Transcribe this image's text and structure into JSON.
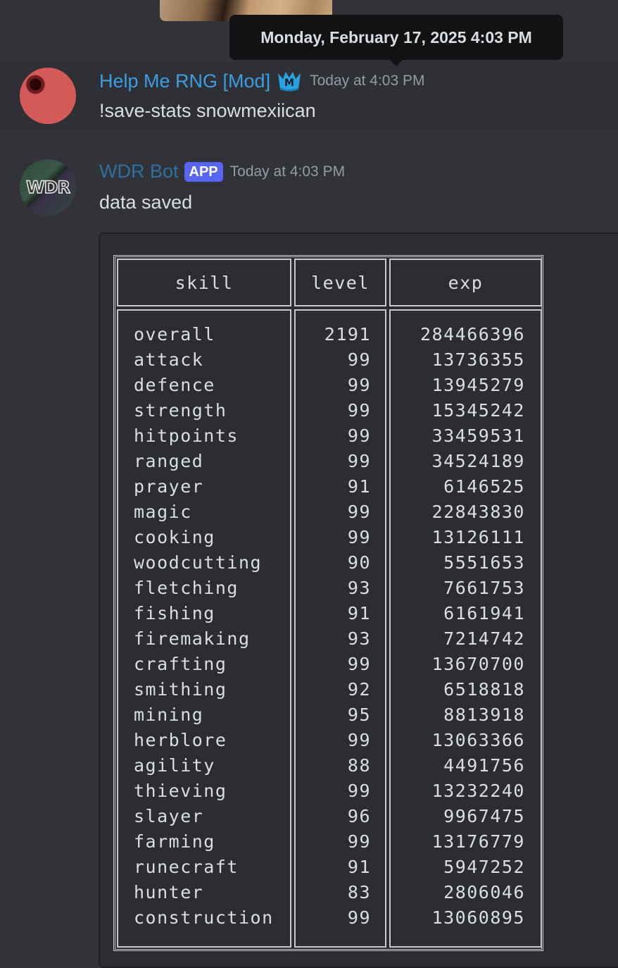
{
  "previous_message": {
    "image": "attachment-thumbnail"
  },
  "tooltip": {
    "text": "Monday, February 17, 2025 4:03 PM"
  },
  "messages": [
    {
      "author": "Help Me RNG [Mod]",
      "author_color": "#3b9ee0",
      "badge_icon": "moderator-crown-icon",
      "timestamp": "Today at 4:03 PM",
      "content": "!save-stats snowmexiican"
    },
    {
      "author": "WDR Bot",
      "author_color": "#2e6f9e",
      "tag": "APP",
      "tag_color": "#5865f2",
      "avatar_text": "WDR",
      "timestamp": "Today at 4:03 PM",
      "content": "data saved"
    }
  ],
  "stats_table": {
    "headers": [
      "skill",
      "level",
      "exp"
    ],
    "rows": [
      {
        "skill": "overall",
        "level": "2191",
        "exp": "284466396"
      },
      {
        "skill": "attack",
        "level": "99",
        "exp": "13736355"
      },
      {
        "skill": "defence",
        "level": "99",
        "exp": "13945279"
      },
      {
        "skill": "strength",
        "level": "99",
        "exp": "15345242"
      },
      {
        "skill": "hitpoints",
        "level": "99",
        "exp": "33459531"
      },
      {
        "skill": "ranged",
        "level": "99",
        "exp": "34524189"
      },
      {
        "skill": "prayer",
        "level": "91",
        "exp": "6146525"
      },
      {
        "skill": "magic",
        "level": "99",
        "exp": "22843830"
      },
      {
        "skill": "cooking",
        "level": "99",
        "exp": "13126111"
      },
      {
        "skill": "woodcutting",
        "level": "90",
        "exp": "5551653"
      },
      {
        "skill": "fletching",
        "level": "93",
        "exp": "7661753"
      },
      {
        "skill": "fishing",
        "level": "91",
        "exp": "6161941"
      },
      {
        "skill": "firemaking",
        "level": "93",
        "exp": "7214742"
      },
      {
        "skill": "crafting",
        "level": "99",
        "exp": "13670700"
      },
      {
        "skill": "smithing",
        "level": "92",
        "exp": "6518818"
      },
      {
        "skill": "mining",
        "level": "95",
        "exp": "8813918"
      },
      {
        "skill": "herblore",
        "level": "99",
        "exp": "13063366"
      },
      {
        "skill": "agility",
        "level": "88",
        "exp": "4491756"
      },
      {
        "skill": "thieving",
        "level": "99",
        "exp": "13232240"
      },
      {
        "skill": "slayer",
        "level": "96",
        "exp": "9967475"
      },
      {
        "skill": "farming",
        "level": "99",
        "exp": "13176779"
      },
      {
        "skill": "runecraft",
        "level": "91",
        "exp": "5947252"
      },
      {
        "skill": "hunter",
        "level": "83",
        "exp": "2806046"
      },
      {
        "skill": "construction",
        "level": "99",
        "exp": "13060895"
      }
    ]
  }
}
